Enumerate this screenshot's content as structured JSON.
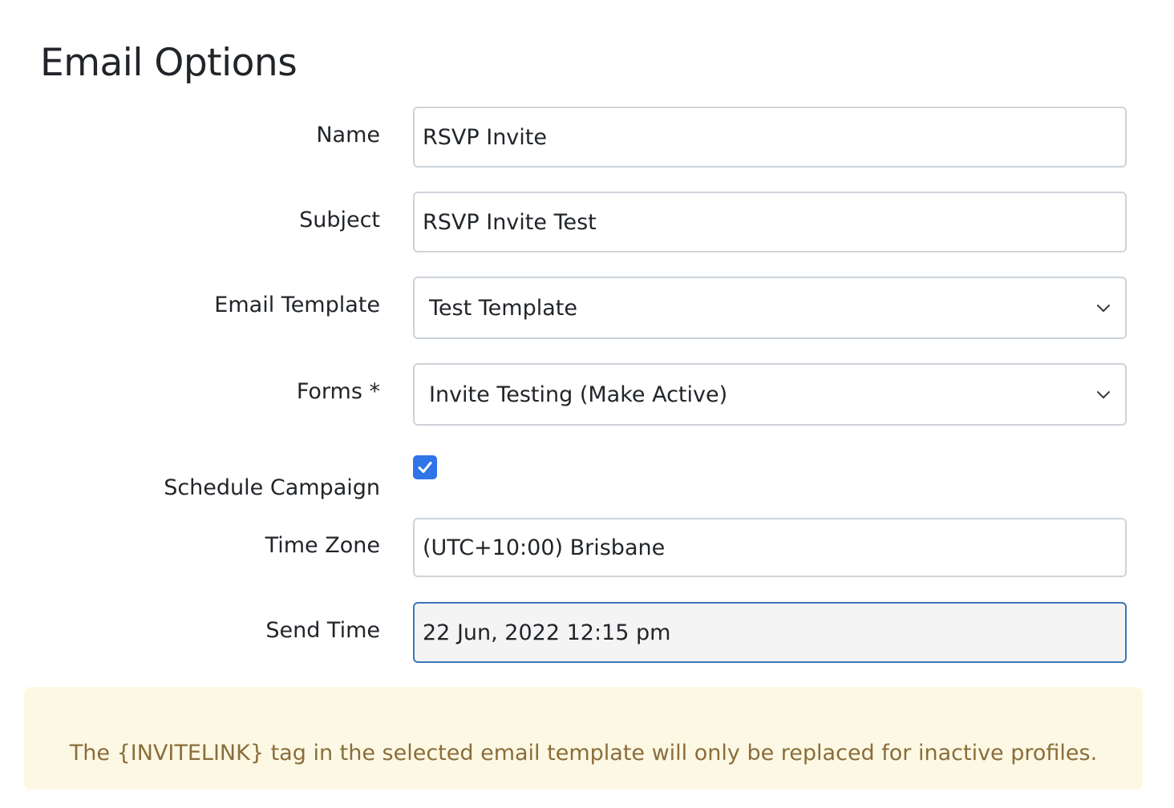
{
  "page": {
    "title": "Email Options"
  },
  "fields": {
    "name": {
      "label": "Name",
      "value": "RSVP Invite"
    },
    "subject": {
      "label": "Subject",
      "value": "RSVP Invite Test"
    },
    "email_template": {
      "label": "Email Template",
      "selected": "Test Template"
    },
    "forms": {
      "label": "Forms *",
      "selected": "Invite Testing (Make Active)"
    },
    "schedule_campaign": {
      "label": "Schedule Campaign",
      "checked": true
    },
    "time_zone": {
      "label": "Time Zone",
      "value": "(UTC+10:00) Brisbane"
    },
    "send_time": {
      "label": "Send Time",
      "value": "22 Jun, 2022 12:15 pm"
    }
  },
  "alert": {
    "text": "The {INVITELINK} tag in the selected email template will only be replaced for inactive profiles."
  },
  "colors": {
    "checkbox": "#2f74e8",
    "focus_border": "#3a78b5",
    "alert_background": "#fcf8e3",
    "alert_text": "#8a6d3b"
  },
  "icons": {
    "select_arrow": "chevron-down-icon",
    "checkbox_mark": "checkmark-icon"
  }
}
